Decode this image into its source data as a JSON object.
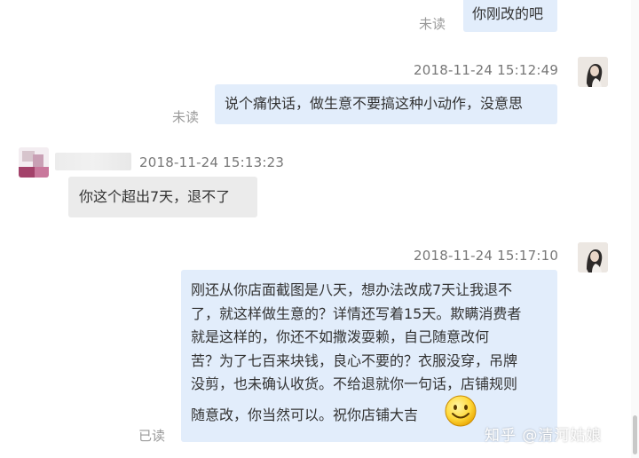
{
  "messages": [
    {
      "direction": "out",
      "text": "你刚改的吧",
      "status": "未读"
    },
    {
      "direction": "out",
      "timestamp": "2018-11-24 15:12:49",
      "text": "说个痛快话，做生意不要搞这种小动作，没意思",
      "status": "未读"
    },
    {
      "direction": "in",
      "timestamp": "2018-11-24 15:13:23",
      "text": "你这个超出7天，退不了"
    },
    {
      "direction": "out",
      "timestamp": "2018-11-24 15:17:10",
      "lines": [
        "刚还从你店面截图是八天，想办法改成7天让我退不",
        "了，就这样做生意的？详情还写着15天。欺瞒消费者",
        "就是这样的，你还不如撒泼耍赖，自己随意改何",
        "苦？为了七百来块钱，良心不要的？衣服没穿，吊牌",
        "没剪，也未确认收货。不给退就你一句话，店铺规则",
        "随意改，你当然可以。祝你店铺大吉"
      ],
      "status": "已读"
    }
  ],
  "watermark": "知乎 @清河姑娘",
  "colors": {
    "outgoing_bubble": "#e2edfb",
    "incoming_bubble": "#ebebeb",
    "status_text": "#9a9a9a",
    "timestamp_text": "#777777"
  }
}
